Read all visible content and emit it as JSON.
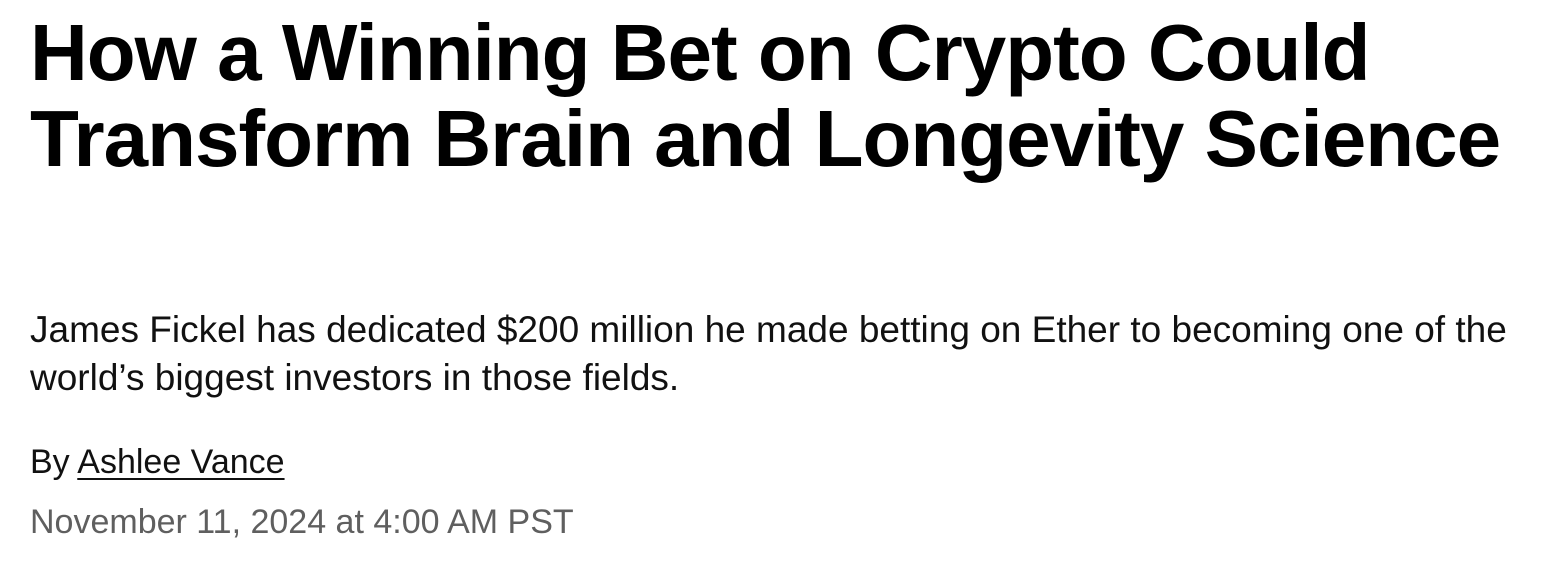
{
  "article": {
    "headline": "How a Winning Bet on Crypto Could Transform Brain and Longevity Science",
    "dek": "James Fickel has dedicated $200 million he made betting on Ether to becoming one of the world’s biggest investors in those fields.",
    "byline": {
      "prefix": "By",
      "author": "Ashlee Vance"
    },
    "published": "November 11, 2024 at 4:00 AM PST"
  }
}
